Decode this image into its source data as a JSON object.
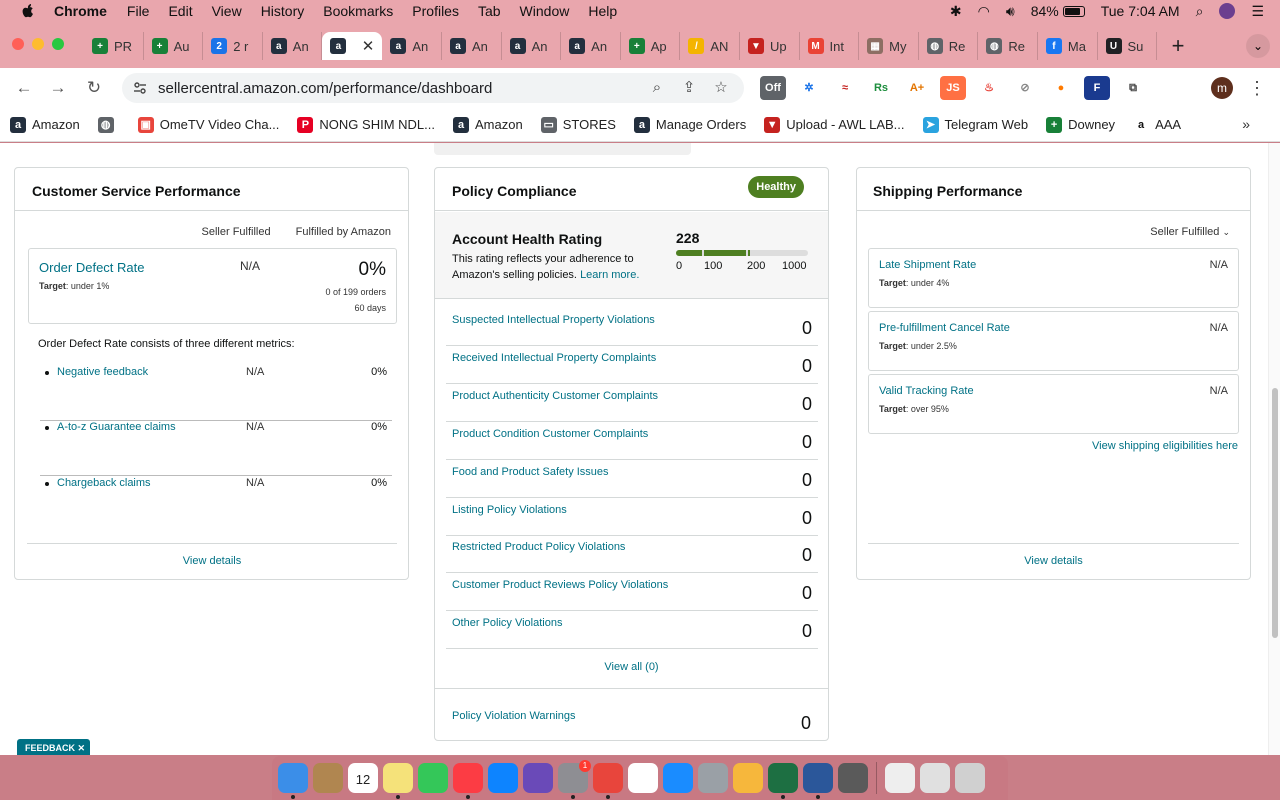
{
  "menubar": {
    "app": "Chrome",
    "items": [
      "File",
      "Edit",
      "View",
      "History",
      "Bookmarks",
      "Profiles",
      "Tab",
      "Window",
      "Help"
    ],
    "battery": "84%",
    "clock": "Tue 7:04 AM"
  },
  "tabs": [
    {
      "label": "PR",
      "color": "#188038",
      "glyph": "+"
    },
    {
      "label": "Au",
      "color": "#188038",
      "glyph": "+"
    },
    {
      "label": "2 r",
      "color": "#1a73e8",
      "glyph": "2"
    },
    {
      "label": "An",
      "color": "#232f3e",
      "glyph": "a"
    },
    {
      "label": "",
      "color": "#232f3e",
      "glyph": "a",
      "active": true
    },
    {
      "label": "An",
      "color": "#232f3e",
      "glyph": "a"
    },
    {
      "label": "An",
      "color": "#232f3e",
      "glyph": "a"
    },
    {
      "label": "An",
      "color": "#232f3e",
      "glyph": "a"
    },
    {
      "label": "An",
      "color": "#232f3e",
      "glyph": "a"
    },
    {
      "label": "Ap",
      "color": "#188038",
      "glyph": "+"
    },
    {
      "label": "AN",
      "color": "#f4b400",
      "glyph": "/"
    },
    {
      "label": "Up",
      "color": "#c5221f",
      "glyph": "▼"
    },
    {
      "label": "Int",
      "color": "#ea4335",
      "glyph": "M"
    },
    {
      "label": "My",
      "color": "#8d6e63",
      "glyph": "▦"
    },
    {
      "label": "Re",
      "color": "#5f6368",
      "glyph": "◍"
    },
    {
      "label": "Re",
      "color": "#5f6368",
      "glyph": "◍"
    },
    {
      "label": "Ma",
      "color": "#1877f2",
      "glyph": "f"
    },
    {
      "label": "Su",
      "color": "#202124",
      "glyph": "U"
    }
  ],
  "omnibox": {
    "url": "sellercentral.amazon.com/performance/dashboard"
  },
  "extensions": [
    {
      "label": "Off",
      "bg": "#5f6368",
      "fg": "#ffffff"
    },
    {
      "label": "✲",
      "bg": "#ffffff",
      "fg": "#1a73e8"
    },
    {
      "label": "≈",
      "bg": "#ffffff",
      "fg": "#c5221f"
    },
    {
      "label": "Rs",
      "bg": "#ffffff",
      "fg": "#1e8e3e"
    },
    {
      "label": "A+",
      "bg": "#ffffff",
      "fg": "#e37400"
    },
    {
      "label": "JS",
      "bg": "#ff7043",
      "fg": "#ffffff"
    },
    {
      "label": "♨",
      "bg": "#ffffff",
      "fg": "#e8453c"
    },
    {
      "label": "⊘",
      "bg": "#ffffff",
      "fg": "#888888"
    },
    {
      "label": "●",
      "bg": "#ffffff",
      "fg": "#ff7a00"
    },
    {
      "label": "F",
      "bg": "#1a3a8f",
      "fg": "#ffffff"
    },
    {
      "label": "⧉",
      "bg": "#ffffff",
      "fg": "#444444"
    }
  ],
  "profile_initial": "m",
  "bookmarks": [
    {
      "label": "Amazon",
      "color": "#232f3e",
      "glyph": "a"
    },
    {
      "label": "",
      "color": "#5f6368",
      "glyph": "◍"
    },
    {
      "label": "OmeTV Video Cha...",
      "color": "#e8453c",
      "glyph": "▣"
    },
    {
      "label": "NONG SHIM NDL...",
      "color": "#e60023",
      "glyph": "P"
    },
    {
      "label": "Amazon",
      "color": "#232f3e",
      "glyph": "a"
    },
    {
      "label": "STORES",
      "color": "#5f6368",
      "glyph": "▭"
    },
    {
      "label": "Manage Orders",
      "color": "#232f3e",
      "glyph": "a"
    },
    {
      "label": "Upload - AWL LAB...",
      "color": "#c5221f",
      "glyph": "▼"
    },
    {
      "label": "Telegram Web",
      "color": "#2aa3df",
      "glyph": "➤"
    },
    {
      "label": "Downey",
      "color": "#188038",
      "glyph": "+"
    },
    {
      "label": "AAA",
      "color": "#ffffff",
      "glyph": "a"
    }
  ],
  "csp": {
    "title": "Customer Service Performance",
    "col_seller": "Seller Fulfilled",
    "col_fba": "Fulfilled by Amazon",
    "odr": {
      "name": "Order Defect Rate",
      "target_label": "Target",
      "target_value": ": under 1%",
      "seller": "N/A",
      "fba": "0%",
      "orders": "0 of 199 orders",
      "days": "60 days"
    },
    "consists": "Order Defect Rate consists of three different metrics:",
    "metrics": [
      {
        "name": "Negative feedback",
        "seller": "N/A",
        "fba": "0%"
      },
      {
        "name": "A-to-z Guarantee claims",
        "seller": "N/A",
        "fba": "0%"
      },
      {
        "name": "Chargeback claims",
        "seller": "N/A",
        "fba": "0%"
      }
    ],
    "view_details": "View details"
  },
  "policy": {
    "title": "Policy Compliance",
    "badge": "Healthy",
    "ahr_title": "Account Health Rating",
    "ahr_desc": "This rating reflects your adherence to Amazon's selling policies.",
    "ahr_learn": "Learn more.",
    "ahr_score": "228",
    "ahr_level": 228,
    "ahr_ticks": [
      "0",
      "100",
      "200",
      "1000"
    ],
    "violations": [
      {
        "name": "Suspected Intellectual Property Violations",
        "count": "0"
      },
      {
        "name": "Received Intellectual Property Complaints",
        "count": "0"
      },
      {
        "name": "Product Authenticity Customer Complaints",
        "count": "0"
      },
      {
        "name": "Product Condition Customer Complaints",
        "count": "0"
      },
      {
        "name": "Food and Product Safety Issues",
        "count": "0"
      },
      {
        "name": "Listing Policy Violations",
        "count": "0"
      },
      {
        "name": "Restricted Product Policy Violations",
        "count": "0"
      },
      {
        "name": "Customer Product Reviews Policy Violations",
        "count": "0"
      },
      {
        "name": "Other Policy Violations",
        "count": "0"
      }
    ],
    "view_all": "View all (0)",
    "warnings": {
      "name": "Policy Violation Warnings",
      "count": "0"
    }
  },
  "shipping": {
    "title": "Shipping Performance",
    "dropdown": "Seller Fulfilled",
    "metrics": [
      {
        "name": "Late Shipment Rate",
        "target_label": "Target",
        "target_value": ": under 4%",
        "value": "N/A"
      },
      {
        "name": "Pre-fulfillment Cancel Rate",
        "target_label": "Target",
        "target_value": ": under 2.5%",
        "value": "N/A"
      },
      {
        "name": "Valid Tracking Rate",
        "target_label": "Target",
        "target_value": ": over 95%",
        "value": "N/A"
      }
    ],
    "eligibilities": "View shipping eligibilities here",
    "view_details": "View details"
  },
  "feedback": "FEEDBACK",
  "dock": [
    {
      "name": "finder",
      "color": "#3b8ee8",
      "running": true
    },
    {
      "name": "notes-app",
      "color": "#b08650",
      "running": false
    },
    {
      "name": "calendar",
      "color": "#ffffff",
      "running": false,
      "label": "12"
    },
    {
      "name": "notes",
      "color": "#f5e27a",
      "running": true
    },
    {
      "name": "facetime",
      "color": "#34c759",
      "running": false
    },
    {
      "name": "music",
      "color": "#fc3c44",
      "running": true
    },
    {
      "name": "app-store",
      "color": "#0d84ff",
      "running": false
    },
    {
      "name": "siri",
      "color": "#6a4ab8",
      "running": false
    },
    {
      "name": "system-settings",
      "color": "#8e8e93",
      "running": true,
      "badge": "1"
    },
    {
      "name": "chrome",
      "color": "#e8453c",
      "running": true
    },
    {
      "name": "reminders",
      "color": "#ffffff",
      "running": false
    },
    {
      "name": "safari",
      "color": "#1a8cff",
      "running": false
    },
    {
      "name": "launchpad",
      "color": "#9aa0a6",
      "running": false
    },
    {
      "name": "photos",
      "color": "#f6b73c",
      "running": false
    },
    {
      "name": "excel",
      "color": "#1d6f42",
      "running": true
    },
    {
      "name": "word",
      "color": "#2b579a",
      "running": true
    },
    {
      "name": "calculator",
      "color": "#5a5a5a",
      "running": false
    },
    {
      "name": "documents",
      "color": "#eeeeee",
      "running": false
    },
    {
      "name": "downloads",
      "color": "#e0e0e0",
      "running": false
    },
    {
      "name": "trash",
      "color": "#d0d0d0",
      "running": false
    }
  ]
}
